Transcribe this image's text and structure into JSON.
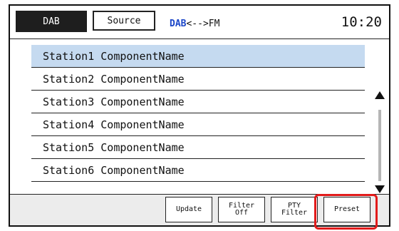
{
  "header": {
    "dab_tab": "DAB",
    "source_button": "Source",
    "mode_dab": "DAB",
    "mode_rest": "<-->FM",
    "clock": "10:20"
  },
  "stations": [
    "Station1 ComponentName",
    "Station2 ComponentName",
    "Station3 ComponentName",
    "Station4 ComponentName",
    "Station5 ComponentName",
    "Station6 ComponentName"
  ],
  "selected_index": 0,
  "icons": {
    "scroll_up": "triangle-up-icon",
    "scroll_down": "triangle-down-icon"
  },
  "softkeys": {
    "update": "Update",
    "filter_off_1": "Filter",
    "filter_off_2": "Off",
    "pty_filter_1": "PTY",
    "pty_filter_2": "Filter",
    "preset": "Preset"
  },
  "colors": {
    "selected_row": "#c5daf0",
    "dab_accent": "#1b46c8",
    "highlight": "#e21b1b"
  }
}
